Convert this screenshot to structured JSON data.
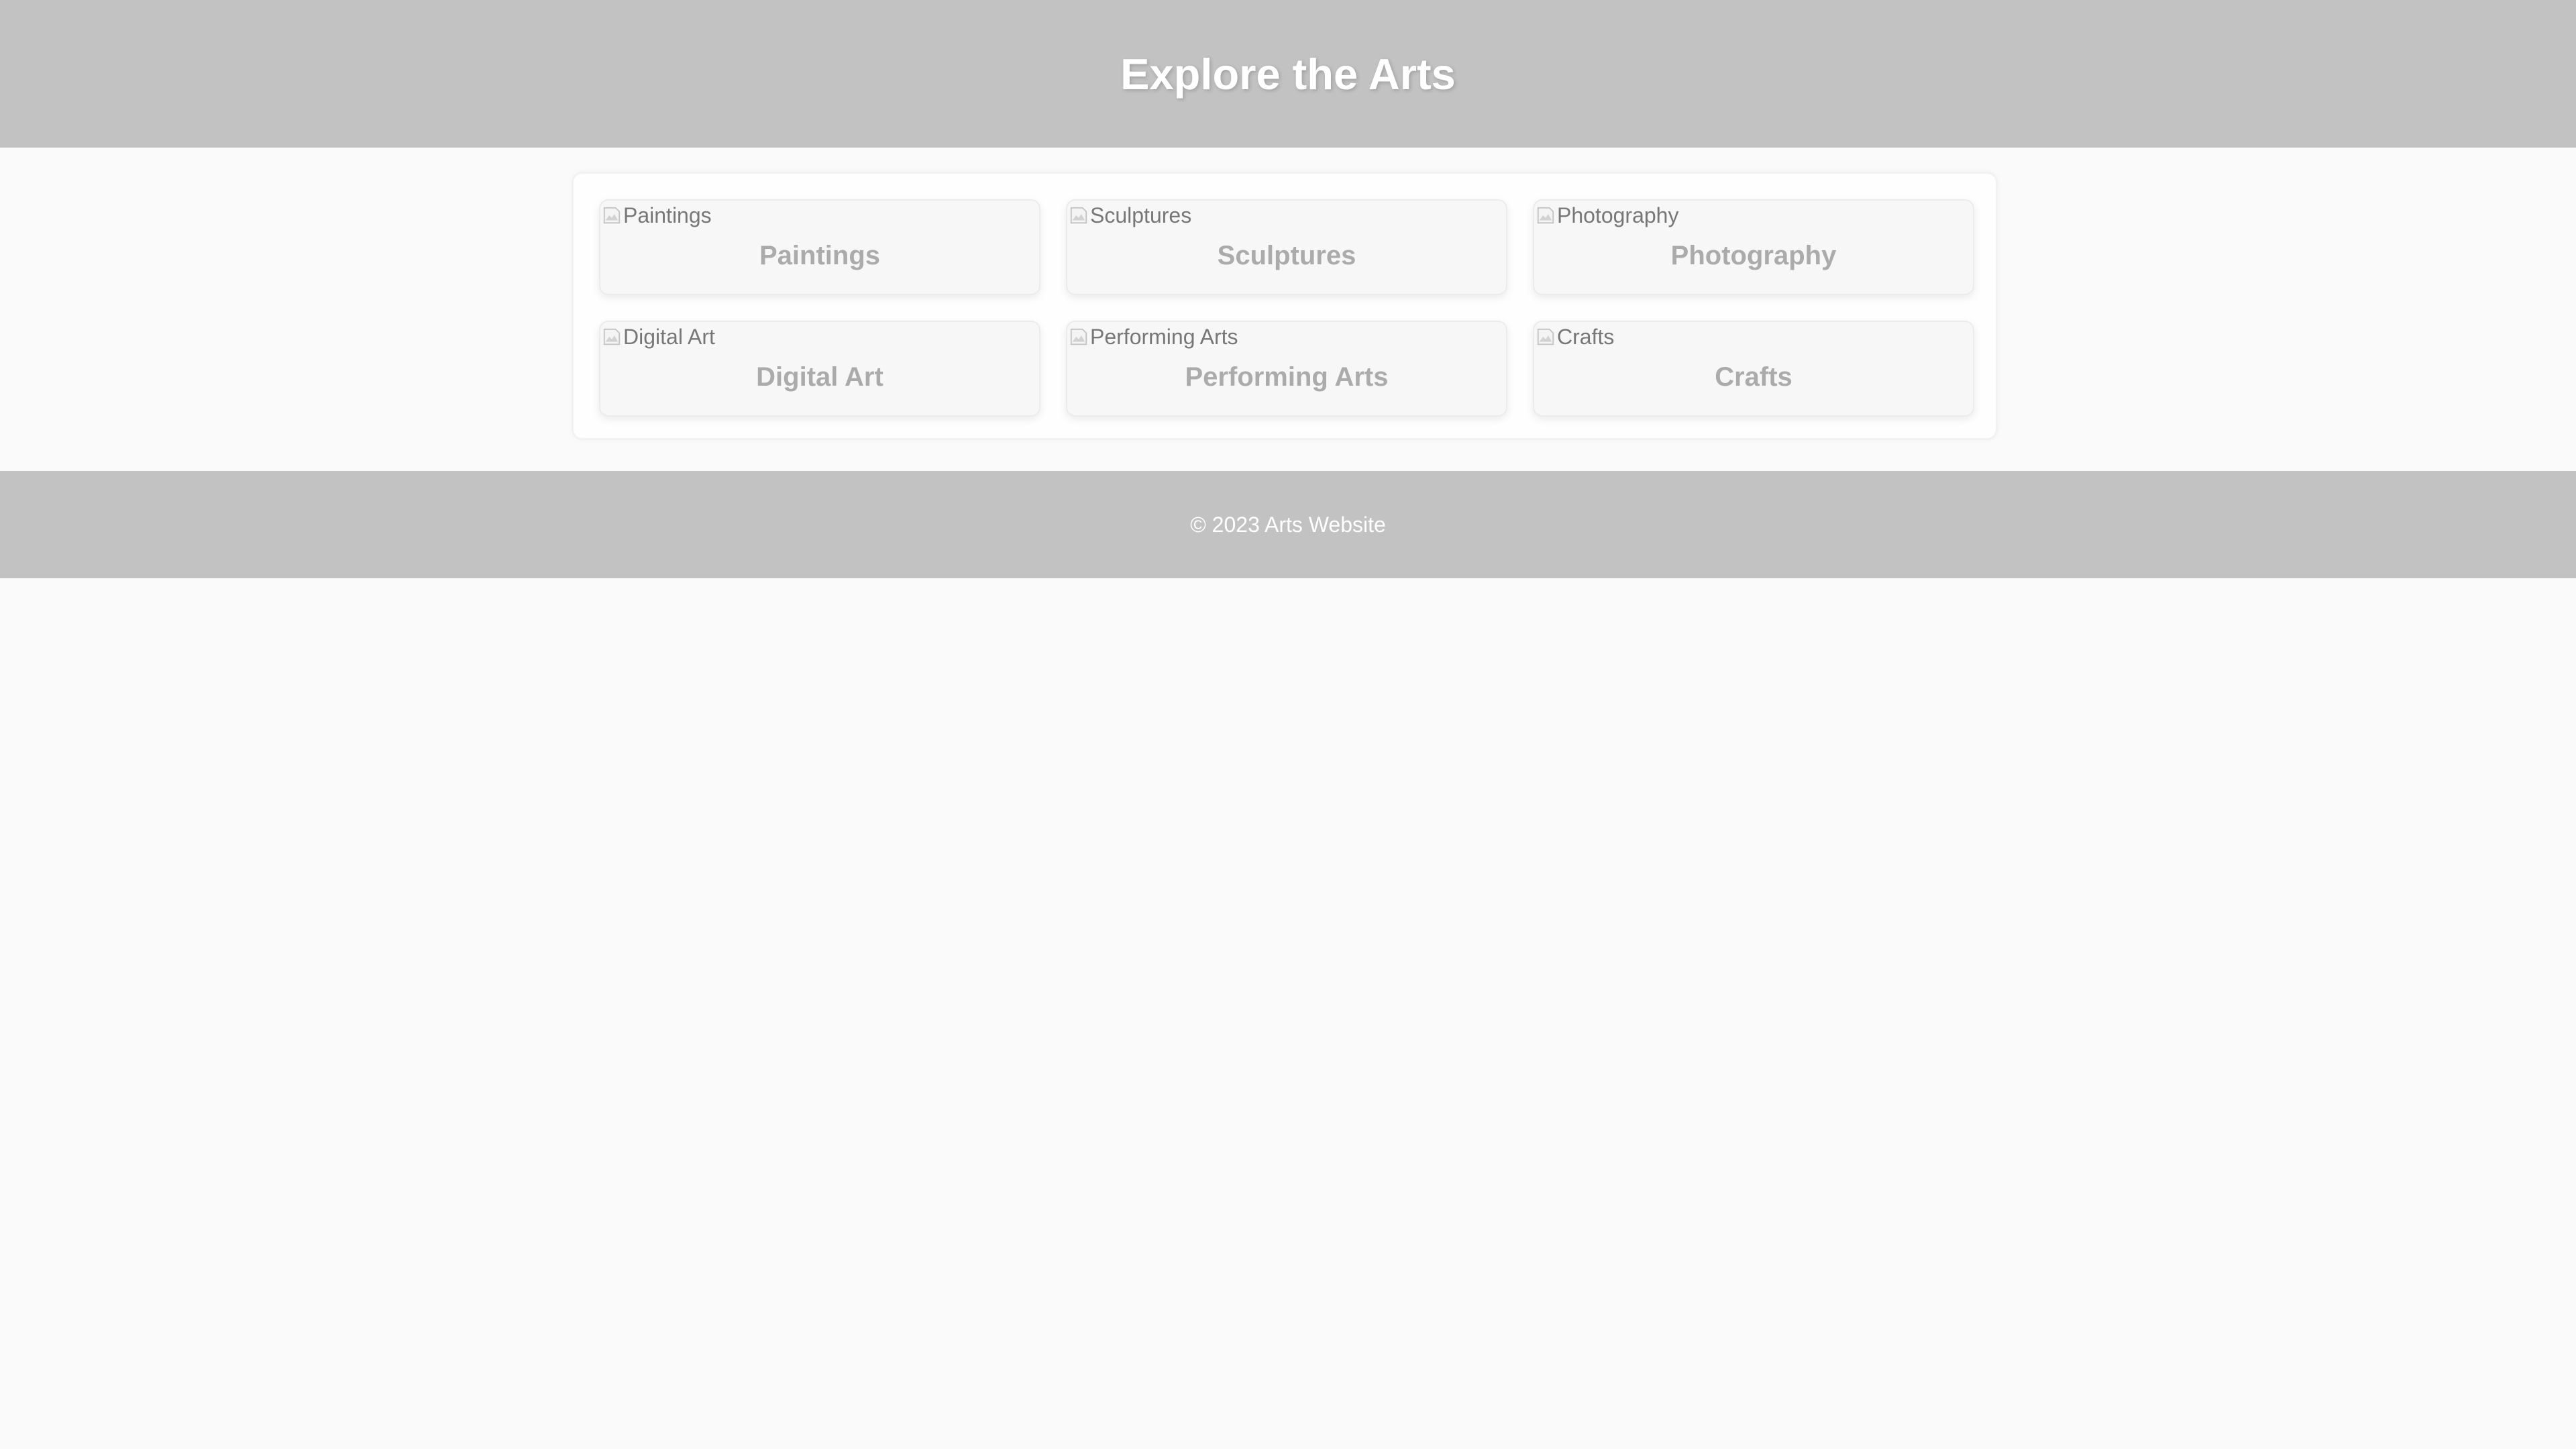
{
  "header": {
    "title": "Explore the Arts"
  },
  "cards": [
    {
      "image_alt": "Paintings",
      "title": "Paintings",
      "image_icon": "broken-image-icon"
    },
    {
      "image_alt": "Sculptures",
      "title": "Sculptures",
      "image_icon": "broken-image-icon"
    },
    {
      "image_alt": "Photography",
      "title": "Photography",
      "image_icon": "broken-image-icon"
    },
    {
      "image_alt": "Digital Art",
      "title": "Digital Art",
      "image_icon": "broken-image-icon"
    },
    {
      "image_alt": "Performing Arts",
      "title": "Performing Arts",
      "image_icon": "broken-image-icon"
    },
    {
      "image_alt": "Crafts",
      "title": "Crafts",
      "image_icon": "broken-image-icon"
    }
  ],
  "footer": {
    "copyright": "© 2023 Arts Website"
  },
  "colors": {
    "header_bg": "#c2c2c2",
    "footer_bg": "#c2c2c2",
    "page_bg": "#fafafa",
    "card_bg": "#f7f7f7",
    "card_title": "#ababab"
  }
}
